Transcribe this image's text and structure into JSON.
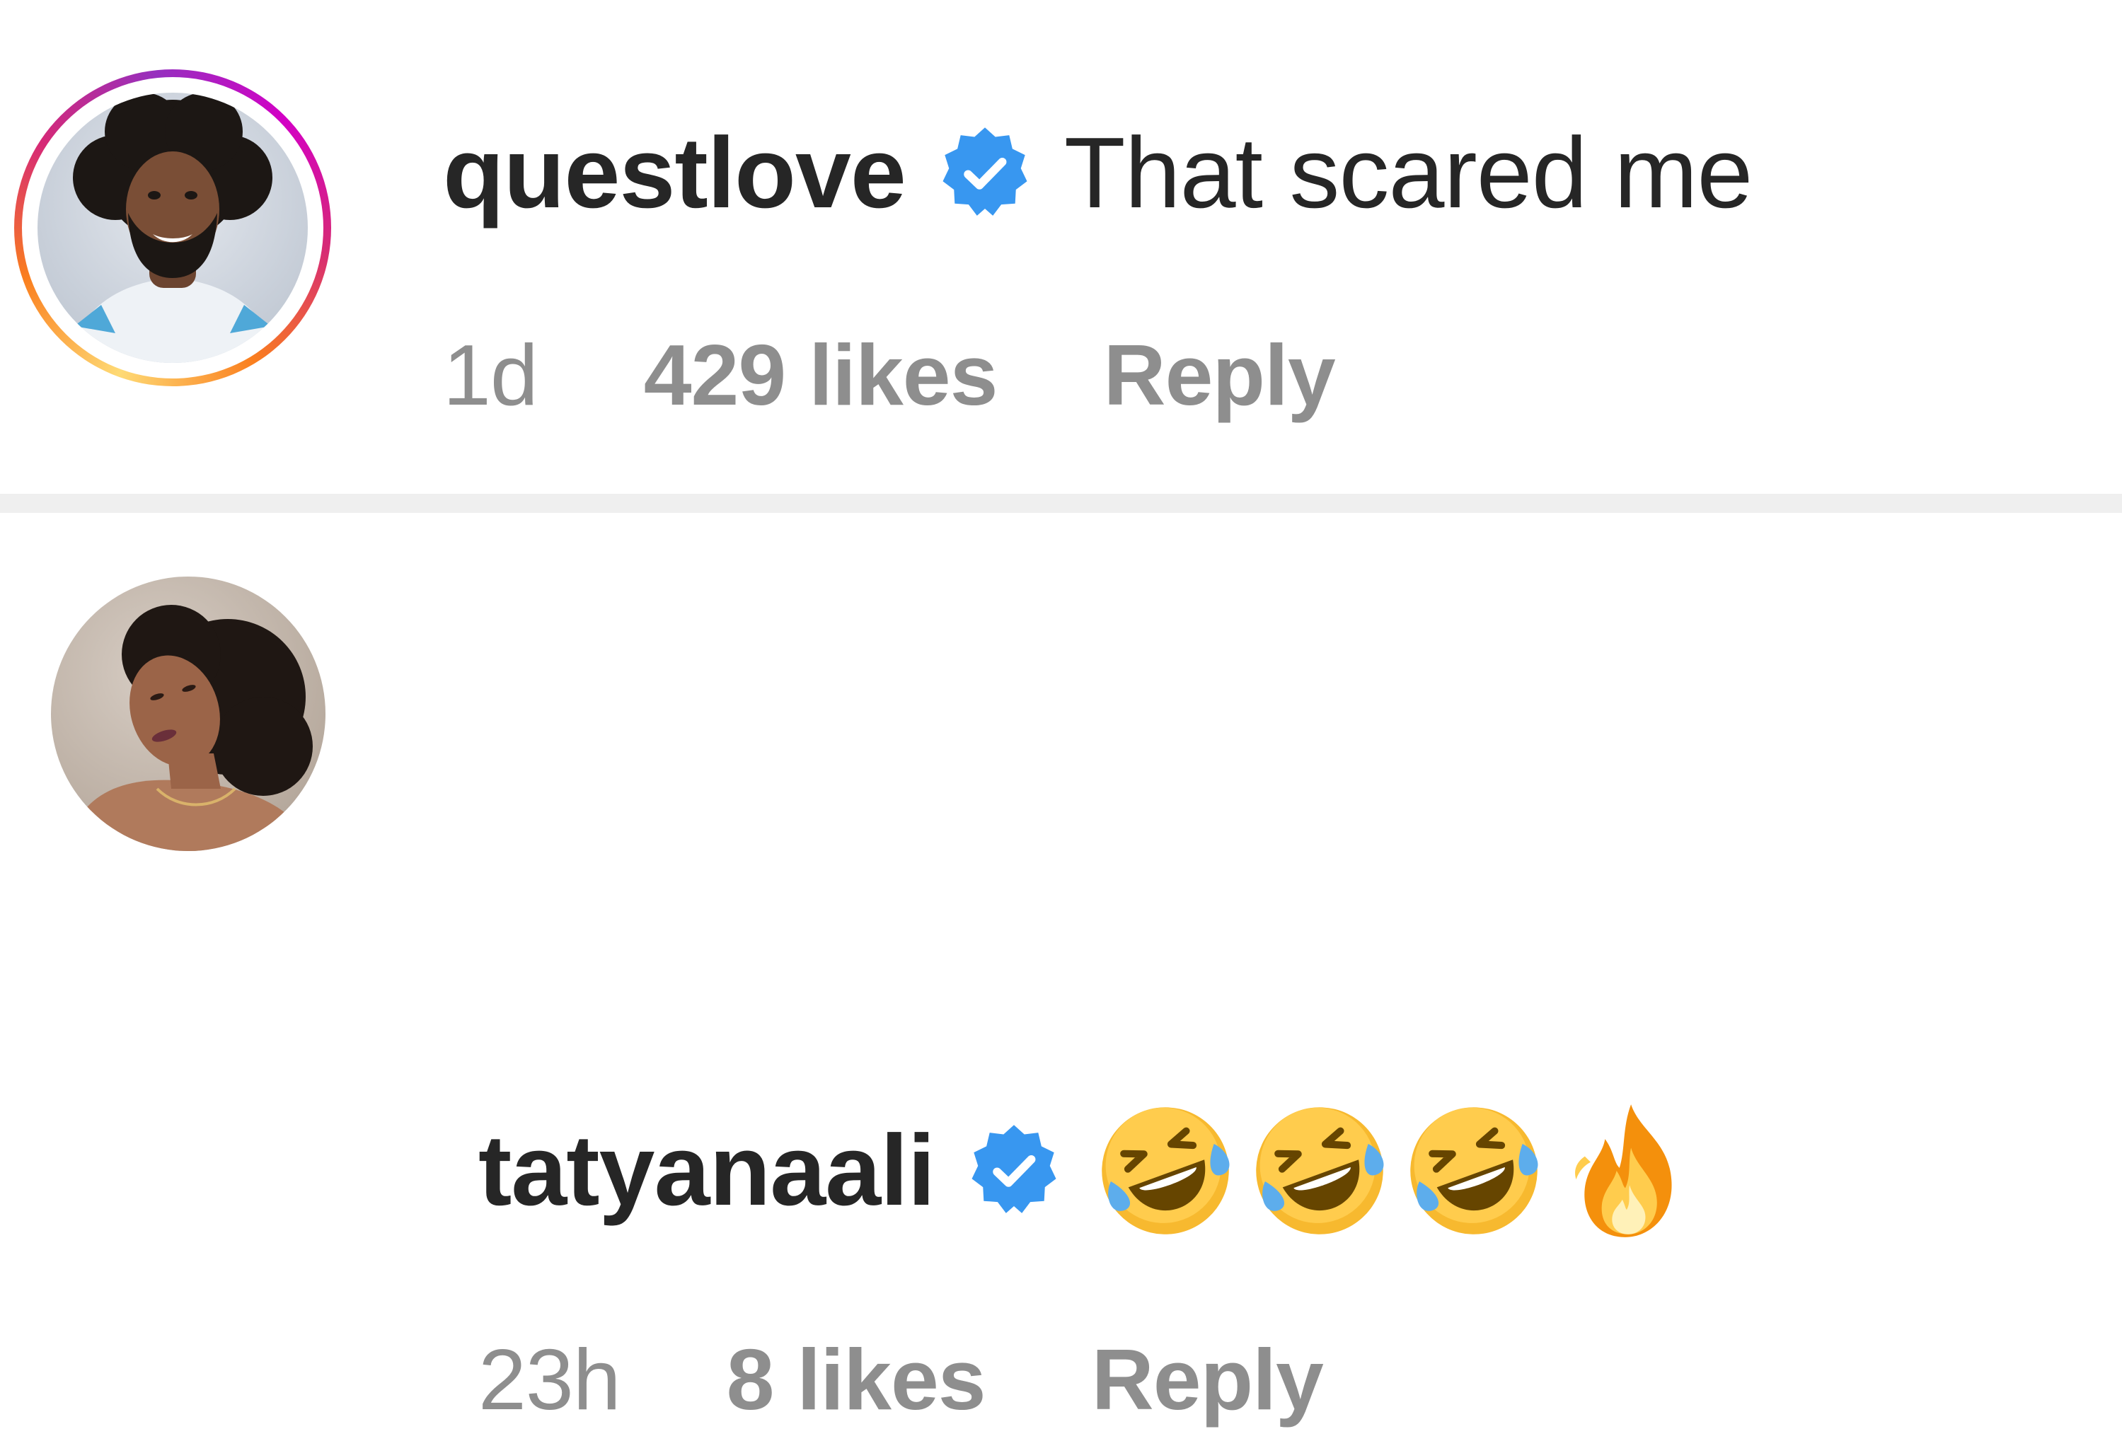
{
  "comments": [
    {
      "username": "questlove",
      "verified": true,
      "has_story_ring": true,
      "text": "That scared me",
      "time": "1d",
      "likes": "429 likes",
      "reply_label": "Reply"
    },
    {
      "username": "tatyanaali",
      "verified": true,
      "has_story_ring": false,
      "text": "🤣🤣🤣🔥",
      "emoji_icons": [
        "rofl-emoji-icon",
        "rofl-emoji-icon",
        "rofl-emoji-icon",
        "fire-emoji-icon"
      ],
      "time": "23h",
      "likes": "8 likes",
      "reply_label": "Reply"
    }
  ],
  "colors": {
    "text_primary": "#262626",
    "text_secondary": "#8e8e8e",
    "verified_blue": "#3897f0",
    "divider": "#efefef",
    "story_ring": [
      "#feda75",
      "#fa7e1e",
      "#d62976",
      "#962fbf",
      "#d300c5"
    ]
  }
}
